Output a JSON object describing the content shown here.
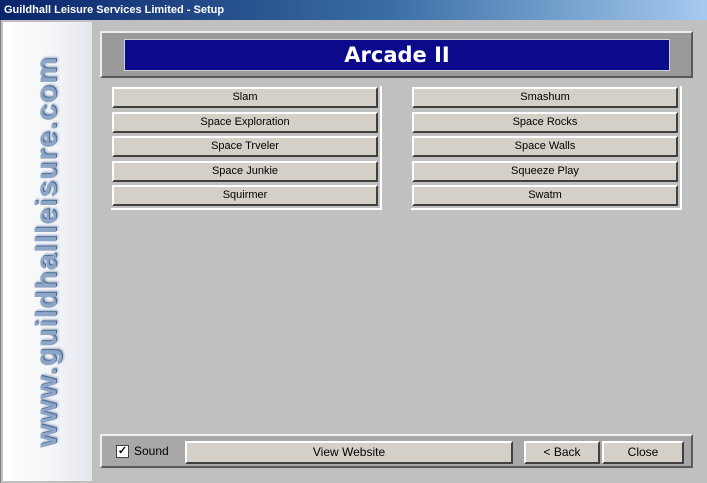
{
  "window": {
    "title": "Guildhall Leisure Services Limited - Setup"
  },
  "banner": {
    "text": "www.guildhallleisure.com"
  },
  "header": {
    "title": "Arcade II"
  },
  "games": {
    "left": [
      "Slam",
      "Space Exploration",
      "Space Trveler",
      "Space Junkie",
      "Squirmer"
    ],
    "right": [
      "Smashum",
      "Space Rocks",
      "Space Walls",
      "Squeeze Play",
      "Swatm"
    ]
  },
  "footer": {
    "sound_label": "Sound",
    "sound_checked": true,
    "check_glyph": "✓",
    "website_label": "View Website",
    "back_label": "< Back",
    "close_label": "Close"
  }
}
